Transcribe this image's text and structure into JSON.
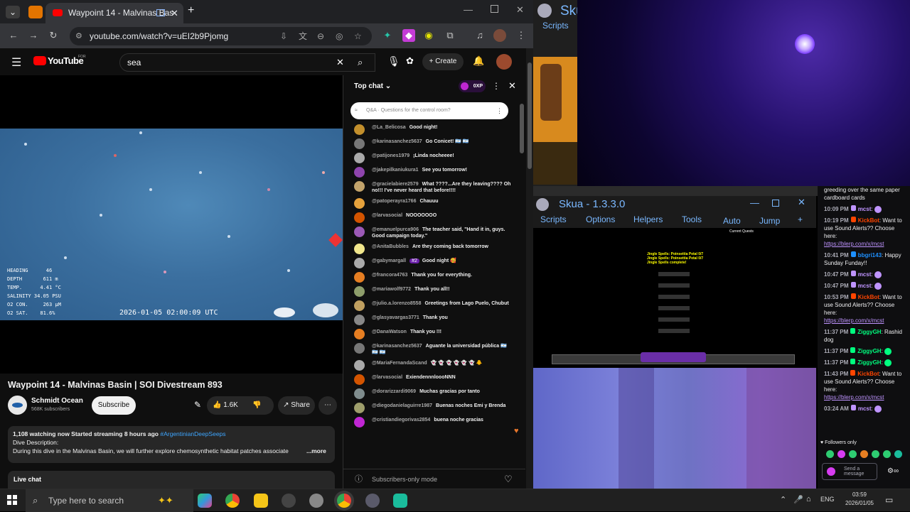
{
  "browser": {
    "tab_title": "Waypoint 14 - Malvinas Bas",
    "url": "youtube.com/watch?v=uEI2b9Pjomg"
  },
  "youtube": {
    "logo": "YouTube",
    "logo_sup": "FOR",
    "search_value": "sea",
    "create_label": "Create",
    "video_title": "Waypoint 14 - Malvinas Basin | SOI Divestream 893",
    "channel_name": "Schmidt Ocean",
    "subscribers": "568K subscribers",
    "subscribe_label": "Subscribe",
    "likes": "1.6K",
    "share_label": "Share",
    "description_meta": "1,108 watching now  Started streaming 8 hours ago",
    "description_hashtag": "#ArgentinianDeepSeeps",
    "description_heading": "Dive Description:",
    "description_text": "During this dive in the Malvinas Basin, we will further explore chemosynthetic habitat patches associate",
    "more_label": "...more",
    "live_chat_label": "Live chat",
    "hud": {
      "heading": "HEADING      46",
      "depth": "DEPTH       611 m",
      "temp": "TEMP.      4.41 °C",
      "salinity": "SALINITY 34.05 PSU",
      "o2con": "O2 CON.     263 µM",
      "o2sat": "O2 SAT.    81.6%",
      "timestamp": "2026-01-05 02:00:09 UTC"
    }
  },
  "chat": {
    "title": "Top chat",
    "points": "0XP",
    "qa_placeholder": "Q&A · Questions for the control room?",
    "footer": "Subscribers-only mode",
    "messages": [
      {
        "author": "@La_Belicosa",
        "text": "Good night!",
        "color": "#c28f2c"
      },
      {
        "author": "@karinasanchez5637",
        "text": "Go Conicet! 🇦🇷 🇦🇷",
        "color": "#777777"
      },
      {
        "author": "@patijones1979",
        "text": "¡Linda nocheeee!",
        "color": "#aaaaaa"
      },
      {
        "author": "@jakepilkaniukura1",
        "text": "See you tomorrow!",
        "color": "#8e44ad"
      },
      {
        "author": "@gracielabiere2579",
        "text": "What ????...Are they leaving???? Oh no!!! I've never heard that before!!!!",
        "color": "#c2a36b"
      },
      {
        "author": "@patoperayra1766",
        "text": "Chauuu",
        "color": "#e6a23c"
      },
      {
        "author": "@larvasocial",
        "text": "NOOOOOOO",
        "color": "#d35400"
      },
      {
        "author": "@emanuelpurca906",
        "text": "The teacher said, \"Hand it in, guys. Good campaign today.\"",
        "color": "#9b59b6"
      },
      {
        "author": "@AnitaBubbles",
        "text": "Are they coming back tomorrow",
        "color": "#f0e68c"
      },
      {
        "author": "@gabymargall",
        "text": "Good night 🥰",
        "color": "#aaaaaa",
        "badge": "#2"
      },
      {
        "author": "@francora4763",
        "text": "Thank you for everything.",
        "color": "#e67e22"
      },
      {
        "author": "@mariawolf9772",
        "text": "Thank you all!!",
        "color": "#8e9e6b"
      },
      {
        "author": "@julio.a.lorenzo8558",
        "text": "Greetings from Lago Puelo, Chubut",
        "color": "#c0a060"
      },
      {
        "author": "@glasyavargas3771",
        "text": "Thank you",
        "color": "#888888"
      },
      {
        "author": "@DanaWatson",
        "text": "Thank you !!!",
        "color": "#e67e22"
      },
      {
        "author": "@karinasanchez5637",
        "text": "Aguante la universidad pública 🇦🇷 🇦🇷 🇦🇷",
        "color": "#777777"
      },
      {
        "author": "@MariaFernandaScand",
        "text": "👻 👻 👻 👻 👻 👻 🐥",
        "color": "#aaaaaa"
      },
      {
        "author": "@larvasocial",
        "text": "ExiendennnloooNNN",
        "color": "#d35400"
      },
      {
        "author": "@dorarizzardi9069",
        "text": "Muchas gracias por tanto",
        "color": "#7f8c8d"
      },
      {
        "author": "@diegodanielaguirre1987",
        "text": "Buenas noches Emi y Brenda",
        "color": "#9e9e6b"
      },
      {
        "author": "@cristiandiegorivas2854",
        "text": "buena noche gracias",
        "color": "#c026d3"
      }
    ]
  },
  "skua": {
    "title_small": "Sku",
    "scripts_small": "Scripts",
    "title": "Skua - 1.3.3.0",
    "menu": [
      "Scripts",
      "Options",
      "Helpers",
      "Tools",
      "Auto",
      "Jump",
      "+"
    ],
    "game_text": [
      "Current Quests",
      "Jingle Spells: Poinsettia Petal 0/7",
      "Jingle Spells: Poinsettia Petal 0/7",
      "Jingle Spells complete!"
    ]
  },
  "twitch": {
    "top_text": "greeding over the same paper cardboard cards",
    "messages": [
      {
        "time": "10:09 PM",
        "user": "mcst",
        "text": "",
        "user_color": "#bf94ff"
      },
      {
        "time": "10:19 PM",
        "user": "KickBot",
        "text": "Want to use Sound Alerts?? Choose here:",
        "link": "https://blerp.com/x/mcst",
        "user_color": "#ff4500"
      },
      {
        "time": "10:41 PM",
        "user": "bbgri143",
        "text": "Happy Sunday Funday!!",
        "user_color": "#1e90ff"
      },
      {
        "time": "10:47 PM",
        "user": "mcst",
        "text": "",
        "user_color": "#bf94ff"
      },
      {
        "time": "10:47 PM",
        "user": "mcst",
        "text": "",
        "user_color": "#bf94ff"
      },
      {
        "time": "10:53 PM",
        "user": "KickBot",
        "text": "Want to use Sound Alerts?? Choose here:",
        "link": "https://blerp.com/x/mcst",
        "user_color": "#ff4500"
      },
      {
        "time": "11:37 PM",
        "user": "ZiggyGH",
        "text": "Rashid dog",
        "user_color": "#00ff7f"
      },
      {
        "time": "11:37 PM",
        "user": "ZiggyGH",
        "text": "",
        "user_color": "#00ff7f"
      },
      {
        "time": "11:37 PM",
        "user": "ZiggyGH",
        "text": "",
        "user_color": "#00ff7f"
      },
      {
        "time": "11:43 PM",
        "user": "KickBot",
        "text": "Want to use Sound Alerts?? Choose here:",
        "link": "https://blerp.com/x/mcst",
        "user_color": "#ff4500"
      },
      {
        "time": "03:24 AM",
        "user": "mcst",
        "text": "",
        "user_color": "#bf94ff"
      }
    ],
    "followers_only": "Followers only",
    "send_placeholder": "Send a message"
  },
  "taskbar": {
    "search_placeholder": "Type here to search",
    "lang": "ENG",
    "time": "03:59",
    "date": "2026/01/05"
  }
}
